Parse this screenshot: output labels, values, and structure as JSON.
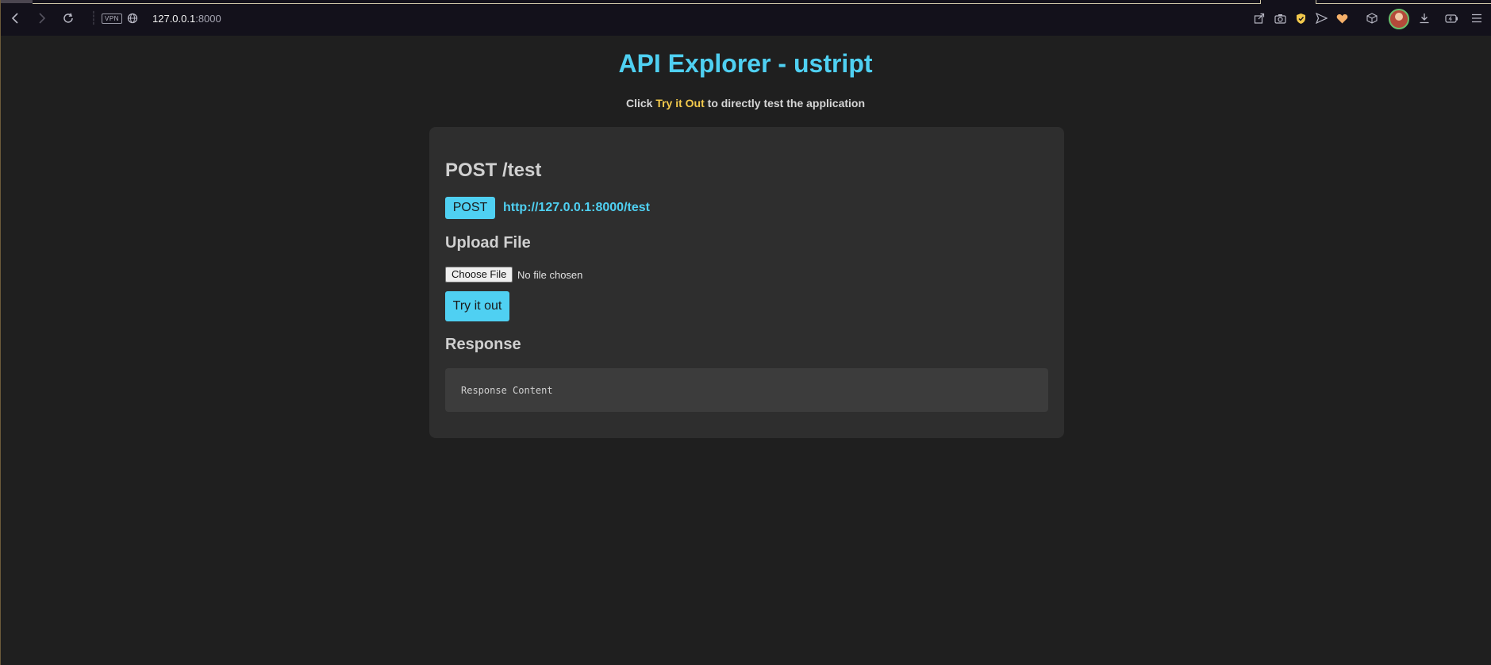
{
  "browser": {
    "url_host": "127.0.0.1",
    "url_port": ":8000",
    "vpn_label": "VPN",
    "icons": [
      "back-icon",
      "forward-icon",
      "reload-icon",
      "vpn-icon",
      "globe-icon",
      "share-icon",
      "camera-icon",
      "shield-icon",
      "send-icon",
      "heart-icon",
      "cube-icon",
      "avatar",
      "download-icon",
      "battery-icon",
      "menu-icon"
    ]
  },
  "page": {
    "title": "API Explorer - ustript",
    "subtitle_prefix": "Click ",
    "subtitle_highlight": "Try it Out",
    "subtitle_suffix": " to directly test the application"
  },
  "endpoint": {
    "title": "POST /test",
    "method": "POST",
    "url": "http://127.0.0.1:8000/test"
  },
  "upload": {
    "heading": "Upload File",
    "choose_label": "Choose File",
    "status": "No file chosen"
  },
  "try_button": "Try it out",
  "response": {
    "heading": "Response",
    "content": "Response Content"
  },
  "colors": {
    "accent": "#4fd0f2",
    "highlight": "#f2c94c",
    "background": "#1f1f1f",
    "panel": "#2e2e2e"
  }
}
